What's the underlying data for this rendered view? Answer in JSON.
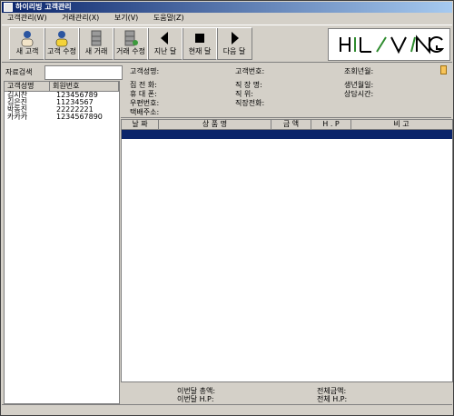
{
  "window": {
    "title": "하이리빙 고객관리"
  },
  "menu": [
    "고객관리(W)",
    "거래관리(X)",
    "보기(V)",
    "도움말(Z)"
  ],
  "toolbar": {
    "buttons": [
      {
        "label": "새 고객",
        "icon": "person-icon"
      },
      {
        "label": "고객 수정",
        "icon": "person-edit-icon"
      },
      {
        "label": "새 거래",
        "icon": "cabinet-icon"
      },
      {
        "label": "거래 수정",
        "icon": "cabinet-edit-icon"
      },
      {
        "label": "지난 달",
        "icon": "arrow-left-icon"
      },
      {
        "label": "현재 달",
        "icon": "stop-square-icon"
      },
      {
        "label": "다음 달",
        "icon": "arrow-right-icon"
      }
    ],
    "logo_text": "HILVING"
  },
  "left": {
    "search_label": "자료검색",
    "search_value": "",
    "list_headers": [
      "고객성명",
      "회원번호"
    ],
    "customers": [
      {
        "name": "김시찬",
        "id": "123456789"
      },
      {
        "name": "김은진",
        "id": "11234567"
      },
      {
        "name": "박동진",
        "id": "22222221"
      },
      {
        "name": "카카카",
        "id": "1234567890"
      }
    ]
  },
  "info": {
    "customer_name": "고객성명:",
    "customer_id": "고객번호:",
    "join_date": "조회년월:",
    "home_phone": "집 전 화:",
    "company": "직 장 명:",
    "birthday": "생년월일:",
    "mobile": "휴 대 폰:",
    "position": "직    위:",
    "consult_time": "상담시간:",
    "zip": "우편번호:",
    "work_phone": "직장전화:",
    "delivery": "택배주소:"
  },
  "grid": {
    "headers": [
      "날  짜",
      "상    품    명",
      "금    액",
      "H . P",
      "비        고"
    ]
  },
  "summary": {
    "month_total": "이번달 총액:",
    "month_hp": "이번달  H.P:",
    "all_total": "전체금액:",
    "all_hp": "전체 H.P:"
  }
}
